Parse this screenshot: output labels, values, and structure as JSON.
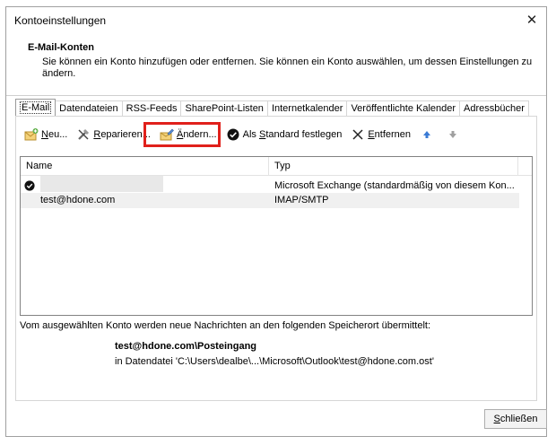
{
  "window": {
    "title": "Kontoeinstellungen",
    "close_glyph": "✕"
  },
  "header": {
    "title": "E-Mail-Konten",
    "description": "Sie können ein Konto hinzufügen oder entfernen. Sie können ein Konto auswählen, um dessen Einstellungen zu ändern."
  },
  "tabs": [
    {
      "label": "E-Mail",
      "active": true
    },
    {
      "label": "Datendateien"
    },
    {
      "label": "RSS-Feeds"
    },
    {
      "label": "SharePoint-Listen"
    },
    {
      "label": "Internetkalender"
    },
    {
      "label": "Veröffentlichte Kalender"
    },
    {
      "label": "Adressbücher"
    }
  ],
  "toolbar": {
    "new_key": "N",
    "new_rest": "eu...",
    "repair_key": "R",
    "repair_rest": "eparieren...",
    "change_key": "Ä",
    "change_rest": "ndern...",
    "default_pre": "Als ",
    "default_key": "S",
    "default_rest": "tandard festlegen",
    "remove_key": "E",
    "remove_rest": "ntfernen"
  },
  "list": {
    "col_name": "Name",
    "col_type": "Typ",
    "rows": [
      {
        "name": "",
        "type": "Microsoft Exchange (standardmäßig von diesem Kon..."
      },
      {
        "name": "test@hdone.com",
        "type": "IMAP/SMTP"
      }
    ]
  },
  "info": {
    "text": "Vom ausgewählten Konto werden neue Nachrichten an den folgenden Speicherort übermittelt:",
    "store": "test@hdone.com\\Posteingang",
    "datafile": "in Datendatei 'C:\\Users\\dealbe\\...\\Microsoft\\Outlook\\test@hdone.com.ost'"
  },
  "footer": {
    "close_key": "S",
    "close_rest": "chließen"
  },
  "colors": {
    "highlight": "#e0201b",
    "up_arrow": "#3a7bd5",
    "down_arrow": "#a0a0a0"
  }
}
